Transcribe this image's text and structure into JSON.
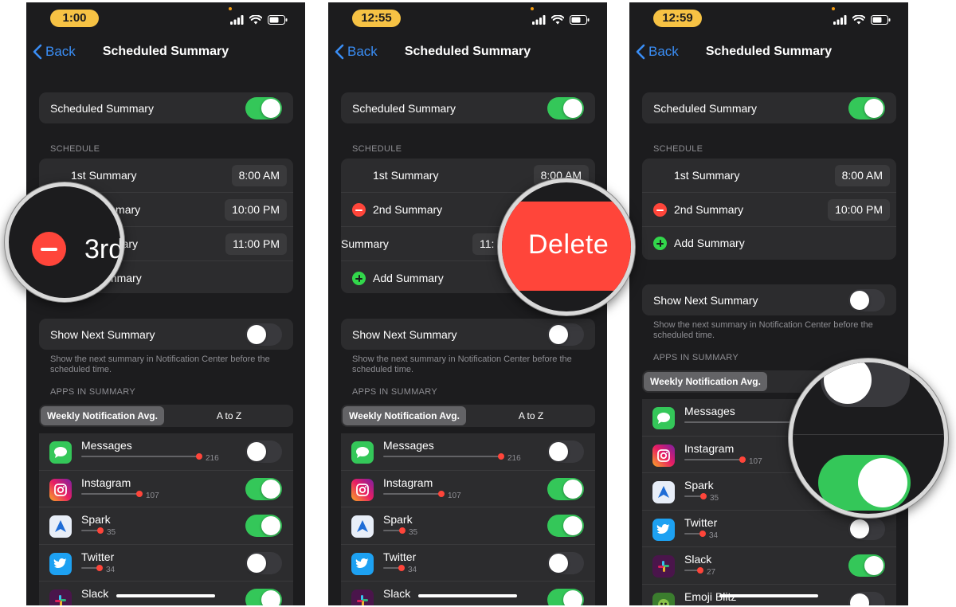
{
  "colors": {
    "accent": "#3a8ef6",
    "on": "#34c759",
    "destructive": "#ff453a",
    "background": "#1c1c1e",
    "cell": "#2c2c2e"
  },
  "icons": [
    "chevron-left-icon",
    "signal-icon",
    "wifi-icon",
    "battery-icon",
    "minus-circle-icon",
    "plus-circle-icon"
  ],
  "nav": {
    "back_label": "Back",
    "title": "Scheduled Summary"
  },
  "labels": {
    "scheduled_summary": "Scheduled Summary",
    "schedule_header": "SCHEDULE",
    "show_next_summary": "Show Next Summary",
    "show_next_footnote": "Show the next summary in Notification Center before the scheduled time.",
    "apps_header": "APPS IN SUMMARY",
    "sort_weekly": "Weekly Notification Avg.",
    "sort_az": "A to Z",
    "add_summary": "Add Summary",
    "delete": "Delete"
  },
  "panels": [
    {
      "time": "1:00",
      "summaries": [
        {
          "label": "1st Summary",
          "time": "8:00 AM"
        },
        {
          "label": "2nd Summary",
          "time": "10:00 PM"
        },
        {
          "label": "3rd Summary",
          "time": "11:00 PM"
        },
        {
          "label": "Add Summary"
        }
      ],
      "magnifier_text": "3rd"
    },
    {
      "time": "12:55",
      "summaries": [
        {
          "label": "1st Summary",
          "time": "8:00 AM"
        },
        {
          "label": "2nd Summary"
        },
        {
          "label": "Summary",
          "time": "11:"
        },
        {
          "label": "Add Summary"
        }
      ]
    },
    {
      "time": "12:59",
      "summaries": [
        {
          "label": "1st Summary",
          "time": "8:00 AM"
        },
        {
          "label": "2nd Summary",
          "time": "10:00 PM"
        },
        {
          "label": "Add Summary"
        }
      ]
    }
  ],
  "apps": [
    {
      "name": "Messages",
      "count": "216",
      "level": 216,
      "enabled": false
    },
    {
      "name": "Instagram",
      "count": "107",
      "level": 107,
      "enabled": true
    },
    {
      "name": "Spark",
      "count": "35",
      "level": 35,
      "enabled": true
    },
    {
      "name": "Twitter",
      "count": "34",
      "level": 34,
      "enabled": false
    },
    {
      "name": "Slack",
      "count": "27",
      "level": 27,
      "enabled": true
    },
    {
      "name": "Emoji Blitz",
      "enabled": false
    }
  ]
}
